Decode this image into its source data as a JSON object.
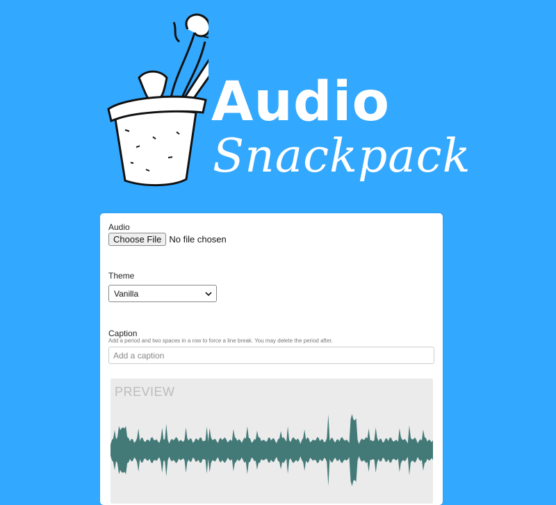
{
  "brand": {
    "word1": "Audio",
    "word2": "Snackpack",
    "color": "#ffffff",
    "background": "#33a8ff"
  },
  "form": {
    "audio": {
      "label": "Audio",
      "button": "Choose File",
      "status": "No file chosen"
    },
    "theme": {
      "label": "Theme",
      "value": "Vanilla"
    },
    "caption": {
      "label": "Caption",
      "hint": "Add a period and two spaces in a row to force a line break. You may delete the period after.",
      "placeholder": "Add a caption"
    }
  },
  "preview": {
    "label": "PREVIEW",
    "wave_color": "#437a78",
    "background": "#ebebeb"
  }
}
